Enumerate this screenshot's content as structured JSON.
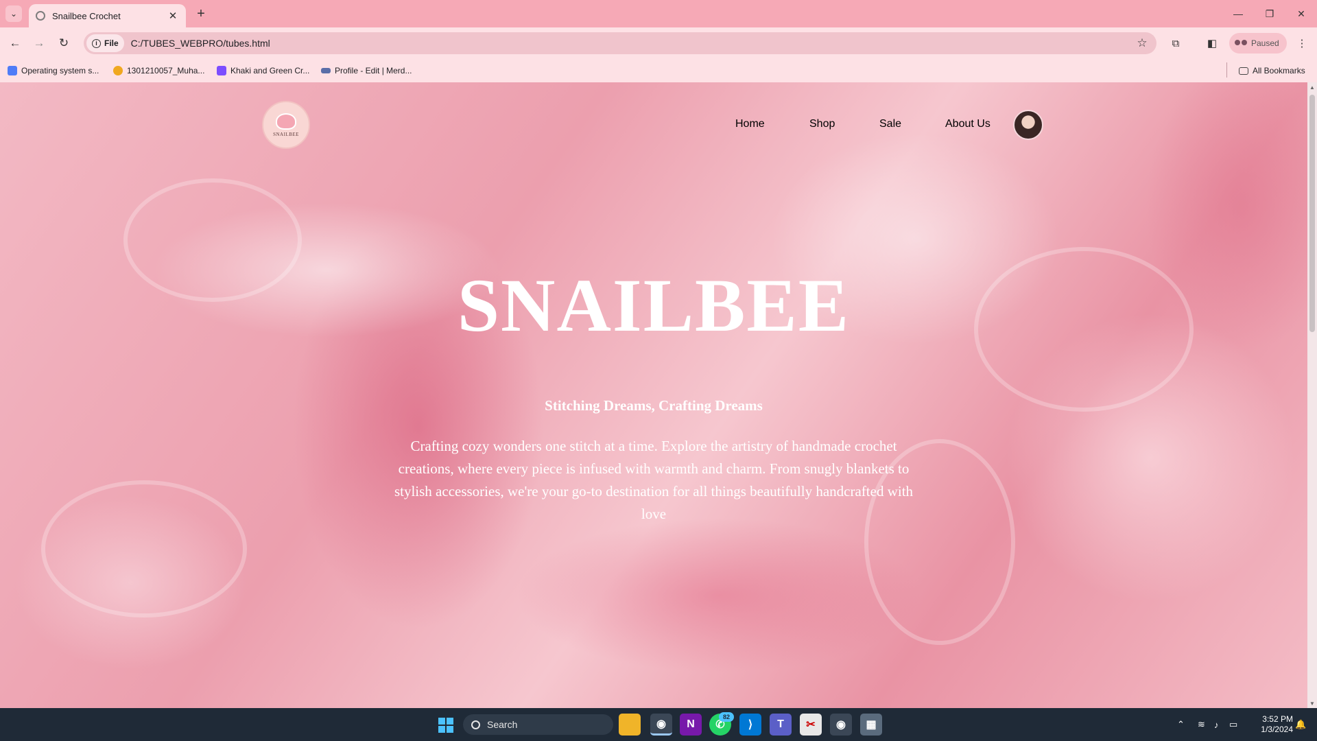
{
  "browser": {
    "tab_title": "Snailbee Crochet",
    "url_chip": "File",
    "url": "C:/TUBES_WEBPRO/tubes.html",
    "profile_label": "Paused",
    "bookmarks": [
      {
        "label": "Operating system s...",
        "icon_color": "#4f7cf7"
      },
      {
        "label": "1301210057_Muha...",
        "icon_color": "#f0a820"
      },
      {
        "label": "Khaki and Green Cr...",
        "icon_color": "#7c4dff"
      },
      {
        "label": "Profile - Edit | Merd...",
        "icon_color": "#5a6ea8"
      }
    ],
    "all_bookmarks": "All Bookmarks"
  },
  "site": {
    "logo_text": "SNAILBEE",
    "nav": [
      "Home",
      "Shop",
      "Sale",
      "About Us"
    ],
    "hero": {
      "title": "SNAILBEE",
      "subtitle": "Stitching Dreams, Crafting Dreams",
      "description": "Crafting cozy wonders one stitch at a time. Explore the artistry of handmade crochet creations, where every piece is infused with warmth and charm. From snugly blankets to stylish accessories, we're your go-to destination for all things beautifully handcrafted with love"
    }
  },
  "taskbar": {
    "search_placeholder": "Search",
    "whatsapp_badge": "82",
    "time": "3:52 PM",
    "date": "1/3/2024"
  },
  "colors": {
    "chrome_accent": "#f6a9b6",
    "chrome_surface": "#fde1e5",
    "taskbar": "#1f2a37",
    "hero_text": "#ffffff"
  }
}
